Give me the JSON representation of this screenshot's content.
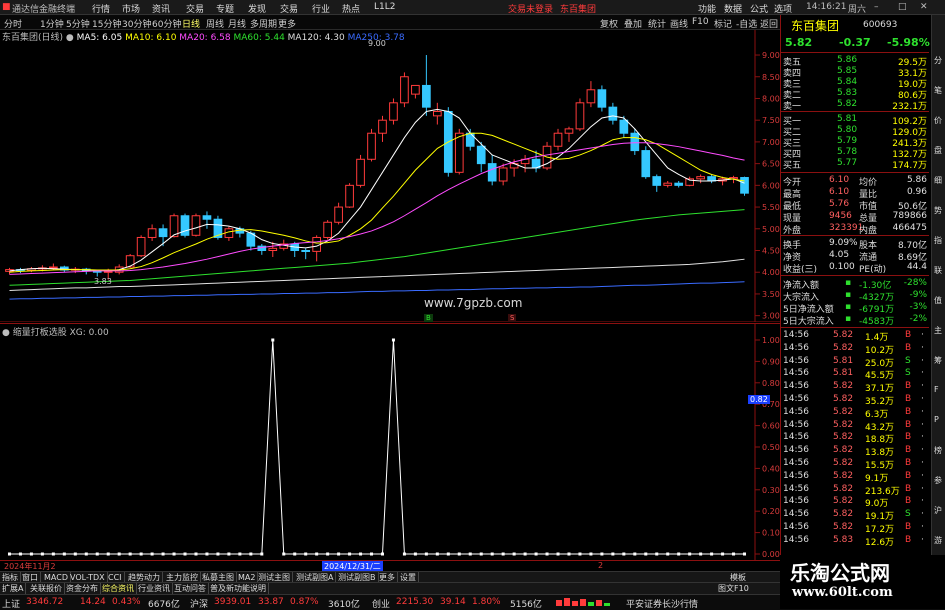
{
  "window": {
    "app_title": "通达信金融终端",
    "menu": [
      "行情",
      "市场",
      "资讯",
      "交易",
      "专题",
      "发现",
      "交易",
      "行业",
      "热点",
      "L1L2"
    ],
    "center_status": "交易未登录",
    "center_stock": "东百集团",
    "right_menu": [
      "功能",
      "数据",
      "公式",
      "选项"
    ],
    "time": "14:16:21",
    "weekday": "周六"
  },
  "periods": [
    "分时",
    "1分钟",
    "5分钟",
    "15分钟",
    "30分钟",
    "60分钟",
    "日线",
    "周线",
    "月线",
    "多周期",
    "更多"
  ],
  "active_period": "日线",
  "toolbar_right": [
    "复权",
    "叠加",
    "统计",
    "画线",
    "F10",
    "标记",
    "-自选",
    "返回"
  ],
  "chart": {
    "stock_label": "东百集团(日线)",
    "ma": [
      {
        "label": "MA5: 6.05",
        "color": "#ffffff"
      },
      {
        "label": "MA10: 6.10",
        "color": "#ffff00"
      },
      {
        "label": "MA20: 6.58",
        "color": "#ff4cff"
      },
      {
        "label": "MA60: 5.44",
        "color": "#2ee02e"
      },
      {
        "label": "MA120: 4.30",
        "color": "#ffffff"
      },
      {
        "label": "MA250: 3.78",
        "color": "#3a6bff"
      }
    ],
    "high_marker": "9.00",
    "low_marker": "3.83",
    "watermark": "www.7gpzb.com",
    "price_ticks": [
      "9.00",
      "8.50",
      "8.00",
      "7.50",
      "7.00",
      "6.50",
      "6.00",
      "5.50",
      "5.00",
      "4.50",
      "4.00",
      "3.50",
      "3.00"
    ],
    "current_price_tag": "0.82",
    "indicator_label": "缩量打板选股 XG: 0.00",
    "indicator_ticks": [
      "1.00",
      "0.90",
      "0.80",
      "0.70",
      "0.60",
      "0.50",
      "0.40",
      "0.30",
      "0.20",
      "0.10",
      "0.00"
    ],
    "date_left": "2024年11月2",
    "date_mid": "2024/12/31/二",
    "date_right": "2",
    "buy_marker": "B",
    "sell_marker": "S"
  },
  "quote": {
    "name": "东百集团",
    "code": "600693",
    "price": "5.82",
    "change": "-0.37",
    "pct": "-5.98%",
    "asks": [
      {
        "label": "卖五",
        "price": "5.86",
        "vol": "29.5万"
      },
      {
        "label": "卖四",
        "price": "5.85",
        "vol": "33.1万"
      },
      {
        "label": "卖三",
        "price": "5.84",
        "vol": "19.0万"
      },
      {
        "label": "卖二",
        "price": "5.83",
        "vol": "80.6万"
      },
      {
        "label": "卖一",
        "price": "5.82",
        "vol": "232.1万"
      }
    ],
    "bids": [
      {
        "label": "买一",
        "price": "5.81",
        "vol": "109.2万"
      },
      {
        "label": "买二",
        "price": "5.80",
        "vol": "129.0万"
      },
      {
        "label": "买三",
        "price": "5.79",
        "vol": "241.3万"
      },
      {
        "label": "买四",
        "price": "5.78",
        "vol": "132.7万"
      },
      {
        "label": "买五",
        "price": "5.77",
        "vol": "174.7万"
      }
    ],
    "stats": [
      {
        "l1": "今开",
        "v1": "6.10",
        "l2": "均价",
        "v2": "5.86"
      },
      {
        "l1": "最高",
        "v1": "6.10",
        "l2": "量比",
        "v2": "0.96"
      },
      {
        "l1": "最低",
        "v1": "5.76",
        "l2": "市值",
        "v2": "50.6亿"
      },
      {
        "l1": "现量",
        "v1": "9456",
        "l2": "总量",
        "v2": "789866"
      },
      {
        "l1": "外盘",
        "v1": "323391",
        "l2": "内盘",
        "v2": "466475"
      }
    ],
    "stats2": [
      {
        "l1": "换手",
        "v1": "9.09%",
        "l2": "股本",
        "v2": "8.70亿"
      },
      {
        "l1": "净资",
        "v1": "4.05",
        "l2": "流通",
        "v2": "8.69亿"
      },
      {
        "l1": "收益(三)",
        "v1": "0.100",
        "l2": "PE(动)",
        "v2": "44.4"
      }
    ],
    "flows": [
      {
        "label": "净流入额",
        "val": "-1.30亿",
        "pct": "-28%"
      },
      {
        "label": "大宗流入",
        "val": "-4327万",
        "pct": "-9%"
      },
      {
        "label": "5日净流入额",
        "val": "-6791万",
        "pct": "-3%"
      },
      {
        "label": "5日大宗流入",
        "val": "-4583万",
        "pct": "-2%"
      }
    ],
    "ticks": [
      {
        "t": "14:56",
        "p": "5.82",
        "v": "1.4万",
        "d": "B"
      },
      {
        "t": "14:56",
        "p": "5.82",
        "v": "10.2万",
        "d": "B"
      },
      {
        "t": "14:56",
        "p": "5.81",
        "v": "25.0万",
        "d": "S"
      },
      {
        "t": "14:56",
        "p": "5.81",
        "v": "45.5万",
        "d": "S"
      },
      {
        "t": "14:56",
        "p": "5.82",
        "v": "37.1万",
        "d": "B"
      },
      {
        "t": "14:56",
        "p": "5.82",
        "v": "35.2万",
        "d": "B"
      },
      {
        "t": "14:56",
        "p": "5.82",
        "v": "6.3万",
        "d": "B"
      },
      {
        "t": "14:56",
        "p": "5.82",
        "v": "43.2万",
        "d": "B"
      },
      {
        "t": "14:56",
        "p": "5.82",
        "v": "18.8万",
        "d": "B"
      },
      {
        "t": "14:56",
        "p": "5.82",
        "v": "13.8万",
        "d": "B"
      },
      {
        "t": "14:56",
        "p": "5.82",
        "v": "15.5万",
        "d": "B"
      },
      {
        "t": "14:56",
        "p": "5.82",
        "v": "9.1万",
        "d": "B"
      },
      {
        "t": "14:56",
        "p": "5.82",
        "v": "213.6万",
        "d": "B"
      },
      {
        "t": "14:56",
        "p": "5.82",
        "v": "9.0万",
        "d": "B"
      },
      {
        "t": "14:56",
        "p": "5.82",
        "v": "19.1万",
        "d": "S"
      },
      {
        "t": "14:56",
        "p": "5.82",
        "v": "17.2万",
        "d": "B"
      },
      {
        "t": "14:56",
        "p": "5.83",
        "v": "12.6万",
        "d": "B"
      }
    ]
  },
  "side_strip": [
    "分",
    "笔",
    "价",
    "盘",
    "细",
    "势",
    "指",
    "联",
    "值",
    "主",
    "筹",
    "F",
    "P",
    "榜",
    "参",
    "沪",
    "游"
  ],
  "tabs1": [
    "指标",
    "窗口",
    "MACD",
    "VOL-TDX",
    "CCI",
    "趋势动力",
    "主力监控",
    "私募主图",
    "MA2",
    "测试主图",
    "测试副图A",
    "测试副图B",
    "更多",
    "设置"
  ],
  "tabs1_right": "模板",
  "tabs2": [
    "扩展A",
    "关联报价",
    "资金分布",
    "综合资讯",
    "行业资讯",
    "互动问答",
    "普及新功能说明"
  ],
  "tabs2_right": "图文F10",
  "status": {
    "sh_label": "上证",
    "sh_val": "3346.72",
    "sh_chg": "14.24",
    "sh_pct": "0.43%",
    "sh_amt": "6676亿",
    "sz_label": "沪深",
    "sz_val": "3939.01",
    "sz_chg": "33.87",
    "sz_pct": "0.87%",
    "sz_amt": "3610亿",
    "cy_label": "创业",
    "cy_val": "2215.30",
    "cy_chg": "39.14",
    "cy_pct": "1.80%",
    "cy_amt": "5156亿",
    "broker": "平安证券长沙行情"
  },
  "site_watermark": {
    "cn": "乐淘公式网",
    "url": "www.60lt.com"
  },
  "colors": {
    "up": "#ff3b3b",
    "down": "#35c8ff",
    "frame": "#8b1010",
    "ma5": "#ffffff",
    "ma10": "#ffff00",
    "ma20": "#ff4cff",
    "ma60": "#2ee02e",
    "ma120": "#e0e0e0",
    "ma250": "#3a6bff"
  },
  "candles": [
    [
      4.02,
      4.06,
      3.95,
      4.1
    ],
    [
      4.06,
      4.04,
      3.98,
      4.1
    ],
    [
      4.04,
      4.08,
      4.0,
      4.12
    ],
    [
      4.08,
      4.1,
      4.02,
      4.16
    ],
    [
      4.1,
      4.12,
      4.05,
      4.2
    ],
    [
      4.12,
      4.05,
      4.0,
      4.15
    ],
    [
      4.05,
      4.07,
      3.98,
      4.12
    ],
    [
      4.07,
      4.04,
      3.95,
      4.1
    ],
    [
      4.04,
      4.0,
      3.9,
      4.05
    ],
    [
      4.0,
      4.02,
      3.83,
      4.08
    ],
    [
      4.0,
      4.12,
      3.95,
      4.18
    ],
    [
      4.12,
      4.38,
      4.1,
      4.42
    ],
    [
      4.38,
      4.8,
      4.35,
      4.85
    ],
    [
      4.8,
      5.0,
      4.72,
      5.1
    ],
    [
      5.0,
      4.82,
      4.6,
      5.1
    ],
    [
      4.82,
      5.3,
      4.8,
      5.35
    ],
    [
      5.3,
      4.85,
      4.8,
      5.35
    ],
    [
      4.85,
      5.3,
      4.82,
      5.35
    ],
    [
      5.3,
      5.22,
      5.0,
      5.4
    ],
    [
      5.22,
      4.8,
      4.75,
      5.3
    ],
    [
      4.8,
      5.0,
      4.72,
      5.05
    ],
    [
      5.0,
      4.9,
      4.8,
      5.05
    ],
    [
      4.9,
      4.6,
      4.5,
      4.95
    ],
    [
      4.6,
      4.5,
      4.4,
      4.65
    ],
    [
      4.5,
      4.55,
      4.35,
      4.7
    ],
    [
      4.55,
      4.65,
      4.5,
      4.75
    ],
    [
      4.65,
      4.5,
      4.35,
      4.7
    ],
    [
      4.5,
      4.48,
      4.3,
      4.55
    ],
    [
      4.48,
      4.8,
      4.25,
      4.85
    ],
    [
      4.8,
      5.15,
      4.75,
      5.2
    ],
    [
      5.15,
      5.5,
      5.1,
      5.6
    ],
    [
      5.5,
      6.0,
      5.48,
      6.05
    ],
    [
      6.0,
      6.6,
      5.95,
      6.7
    ],
    [
      6.6,
      7.2,
      6.55,
      7.3
    ],
    [
      7.2,
      7.5,
      7.0,
      7.6
    ],
    [
      7.5,
      7.9,
      7.4,
      8.0
    ],
    [
      7.9,
      8.5,
      7.8,
      8.6
    ],
    [
      8.1,
      8.3,
      8.0,
      8.3
    ],
    [
      8.3,
      7.8,
      7.6,
      9.0
    ],
    [
      7.6,
      7.7,
      7.4,
      7.9
    ],
    [
      7.7,
      6.3,
      6.2,
      7.8
    ],
    [
      6.3,
      7.2,
      6.25,
      7.3
    ],
    [
      7.2,
      6.9,
      6.8,
      7.3
    ],
    [
      6.9,
      6.5,
      6.3,
      7.0
    ],
    [
      6.5,
      6.1,
      6.0,
      6.7
    ],
    [
      6.1,
      6.4,
      6.0,
      6.5
    ],
    [
      6.4,
      6.5,
      6.2,
      6.6
    ],
    [
      6.5,
      6.6,
      6.3,
      6.7
    ],
    [
      6.6,
      6.4,
      6.3,
      6.8
    ],
    [
      6.4,
      6.9,
      6.35,
      7.0
    ],
    [
      6.9,
      7.2,
      6.8,
      7.3
    ],
    [
      7.2,
      7.3,
      7.0,
      7.35
    ],
    [
      7.3,
      7.9,
      7.25,
      8.0
    ],
    [
      7.9,
      8.2,
      7.8,
      8.4
    ],
    [
      8.2,
      7.8,
      7.7,
      8.3
    ],
    [
      7.8,
      7.5,
      7.4,
      7.9
    ],
    [
      7.5,
      7.2,
      7.1,
      7.6
    ],
    [
      7.2,
      6.8,
      6.7,
      7.3
    ],
    [
      6.8,
      6.2,
      6.15,
      6.9
    ],
    [
      6.2,
      6.0,
      5.85,
      6.25
    ],
    [
      6.0,
      6.05,
      5.95,
      6.1
    ],
    [
      6.05,
      6.0,
      5.95,
      6.1
    ],
    [
      6.0,
      6.15,
      5.98,
      6.2
    ],
    [
      6.15,
      6.2,
      6.05,
      6.25
    ],
    [
      6.2,
      6.1,
      6.05,
      6.25
    ],
    [
      6.1,
      6.15,
      6.0,
      6.2
    ],
    [
      6.15,
      6.18,
      6.05,
      6.22
    ],
    [
      6.18,
      5.82,
      5.76,
      6.2
    ]
  ],
  "ma_series": {
    "ma5": [
      4.03,
      4.06,
      4.08,
      4.09,
      4.08,
      4.07,
      4.06,
      4.05,
      4.04,
      4.03,
      4.06,
      4.14,
      4.28,
      4.47,
      4.66,
      4.86,
      4.95,
      5.02,
      5.1,
      5.09,
      5.06,
      5.0,
      4.9,
      4.75,
      4.66,
      4.62,
      4.58,
      4.56,
      4.6,
      4.72,
      4.9,
      5.2,
      5.5,
      5.9,
      6.3,
      6.7,
      7.1,
      7.45,
      7.7,
      7.75,
      7.7,
      7.55,
      7.2,
      6.95,
      6.7,
      6.6,
      6.5,
      6.4,
      6.4,
      6.5,
      6.65,
      6.85,
      7.1,
      7.35,
      7.55,
      7.6,
      7.55,
      7.3,
      7.0,
      6.7,
      6.4,
      6.25,
      6.12,
      6.1,
      6.1,
      6.12,
      6.15,
      6.05
    ],
    "ma10": [
      4.0,
      4.02,
      4.03,
      4.04,
      4.05,
      4.06,
      4.06,
      4.06,
      4.05,
      4.05,
      4.05,
      4.08,
      4.13,
      4.22,
      4.33,
      4.45,
      4.55,
      4.65,
      4.76,
      4.85,
      4.93,
      4.97,
      4.98,
      4.95,
      4.9,
      4.85,
      4.79,
      4.72,
      4.67,
      4.68,
      4.72,
      4.85,
      5.0,
      5.2,
      5.48,
      5.75,
      6.05,
      6.35,
      6.6,
      6.85,
      7.0,
      7.12,
      7.2,
      7.2,
      7.15,
      7.05,
      6.95,
      6.85,
      6.75,
      6.65,
      6.6,
      6.62,
      6.7,
      6.8,
      6.92,
      7.05,
      7.1,
      7.1,
      7.05,
      6.95,
      6.8,
      6.65,
      6.5,
      6.35,
      6.25,
      6.18,
      6.14,
      6.1
    ],
    "ma20": [
      3.95,
      3.96,
      3.97,
      3.98,
      3.99,
      4.0,
      4.01,
      4.02,
      4.03,
      4.03,
      4.03,
      4.04,
      4.06,
      4.09,
      4.12,
      4.16,
      4.2,
      4.25,
      4.3,
      4.36,
      4.42,
      4.48,
      4.53,
      4.57,
      4.6,
      4.63,
      4.66,
      4.68,
      4.7,
      4.73,
      4.77,
      4.82,
      4.88,
      4.95,
      5.05,
      5.16,
      5.3,
      5.45,
      5.6,
      5.76,
      5.9,
      6.03,
      6.15,
      6.27,
      6.37,
      6.46,
      6.54,
      6.6,
      6.66,
      6.7,
      6.74,
      6.78,
      6.82,
      6.86,
      6.9,
      6.94,
      6.97,
      6.98,
      6.98,
      6.96,
      6.93,
      6.89,
      6.84,
      6.79,
      6.74,
      6.69,
      6.63,
      6.58
    ],
    "ma60": [
      3.7,
      3.71,
      3.72,
      3.73,
      3.74,
      3.75,
      3.76,
      3.77,
      3.78,
      3.79,
      3.8,
      3.81,
      3.83,
      3.85,
      3.87,
      3.89,
      3.91,
      3.93,
      3.95,
      3.97,
      3.99,
      4.01,
      4.03,
      4.05,
      4.07,
      4.09,
      4.11,
      4.13,
      4.15,
      4.17,
      4.19,
      4.21,
      4.24,
      4.27,
      4.3,
      4.33,
      4.36,
      4.4,
      4.44,
      4.48,
      4.52,
      4.56,
      4.6,
      4.64,
      4.68,
      4.72,
      4.76,
      4.8,
      4.84,
      4.88,
      4.92,
      4.96,
      5.0,
      5.04,
      5.08,
      5.12,
      5.16,
      5.2,
      5.23,
      5.26,
      5.29,
      5.32,
      5.34,
      5.36,
      5.38,
      5.4,
      5.42,
      5.44
    ],
    "ma120": [
      3.58,
      3.59,
      3.6,
      3.61,
      3.62,
      3.63,
      3.64,
      3.64,
      3.65,
      3.66,
      3.67,
      3.67,
      3.68,
      3.69,
      3.7,
      3.71,
      3.72,
      3.73,
      3.74,
      3.75,
      3.76,
      3.77,
      3.78,
      3.79,
      3.8,
      3.81,
      3.82,
      3.83,
      3.84,
      3.85,
      3.86,
      3.87,
      3.88,
      3.89,
      3.9,
      3.91,
      3.92,
      3.93,
      3.94,
      3.95,
      3.96,
      3.97,
      3.98,
      3.99,
      4.0,
      4.01,
      4.02,
      4.03,
      4.04,
      4.05,
      4.06,
      4.07,
      4.08,
      4.09,
      4.1,
      4.11,
      4.12,
      4.13,
      4.14,
      4.15,
      4.16,
      4.17,
      4.18,
      4.2,
      4.22,
      4.24,
      4.27,
      4.3
    ],
    "ma250": [
      3.38,
      3.39,
      3.39,
      3.4,
      3.4,
      3.41,
      3.41,
      3.42,
      3.42,
      3.43,
      3.43,
      3.44,
      3.44,
      3.45,
      3.45,
      3.46,
      3.46,
      3.47,
      3.47,
      3.48,
      3.48,
      3.49,
      3.49,
      3.5,
      3.5,
      3.51,
      3.51,
      3.52,
      3.52,
      3.53,
      3.53,
      3.54,
      3.55,
      3.56,
      3.56,
      3.57,
      3.57,
      3.58,
      3.58,
      3.59,
      3.59,
      3.6,
      3.6,
      3.61,
      3.62,
      3.62,
      3.63,
      3.63,
      3.64,
      3.64,
      3.65,
      3.65,
      3.66,
      3.66,
      3.67,
      3.68,
      3.69,
      3.7,
      3.7,
      3.71,
      3.72,
      3.73,
      3.74,
      3.75,
      3.75,
      3.76,
      3.77,
      3.78
    ]
  },
  "indicator_values": [
    0,
    0,
    0,
    0,
    0,
    0,
    0,
    0,
    0,
    0,
    0,
    0,
    0,
    0,
    0,
    0,
    0,
    0,
    0,
    0,
    0,
    0,
    0,
    0,
    0,
    0,
    0,
    0,
    0,
    0,
    0,
    0,
    0,
    0,
    0,
    1,
    0,
    0,
    0,
    0,
    0,
    0,
    0,
    0,
    0,
    0,
    0,
    0,
    0,
    0,
    0,
    0,
    0,
    0,
    0,
    0,
    0,
    0,
    0,
    0,
    0,
    0,
    0,
    0,
    0,
    0,
    0,
    0
  ]
}
